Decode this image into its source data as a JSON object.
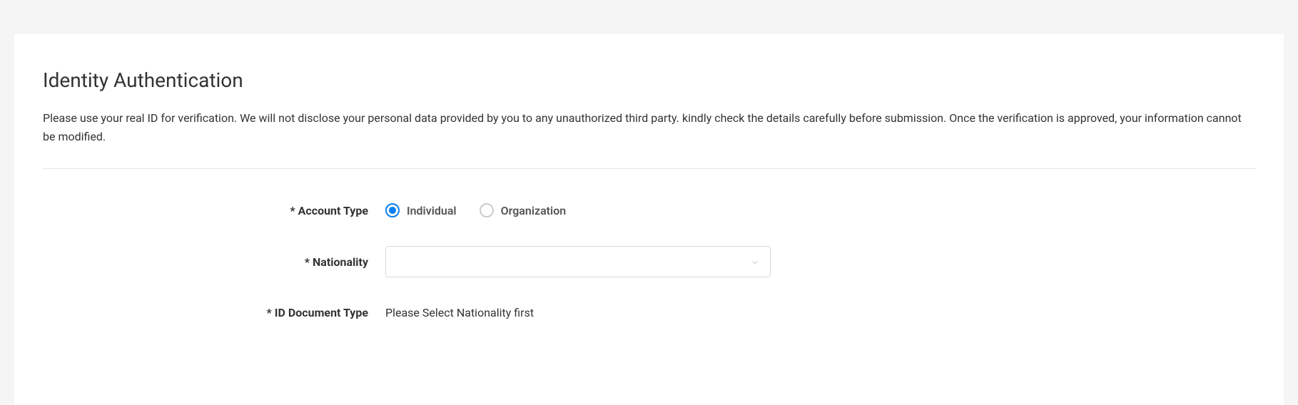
{
  "page": {
    "title": "Identity Authentication",
    "description": "Please use your real ID for verification. We will not disclose your personal data provided by you to any unauthorized third party. kindly check the details carefully before submission. Once the verification is approved, your information cannot be modified."
  },
  "form": {
    "required_mark": "*",
    "account_type": {
      "label": "Account Type",
      "options": {
        "individual": "Individual",
        "organization": "Organization"
      },
      "selected": "individual"
    },
    "nationality": {
      "label": "Nationality",
      "value": ""
    },
    "id_document_type": {
      "label": "ID Document Type",
      "placeholder": "Please Select Nationality first"
    }
  }
}
